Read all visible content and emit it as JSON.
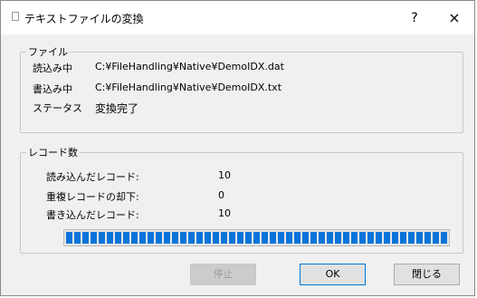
{
  "window": {
    "title": "テキストファイルの変換",
    "help_label": "?",
    "close_label": "×"
  },
  "file_group": {
    "legend": "ファイル",
    "read_label": "読込み中",
    "read_value": "C:¥FileHandling¥Native¥DemoIDX.dat",
    "write_label": "書込み中",
    "write_value": "C:¥FileHandling¥Native¥DemoIDX.txt",
    "status_label": "ステータス",
    "status_value": "変換完了"
  },
  "record_group": {
    "legend": "レコード数",
    "read_label": "読み込んだレコード:",
    "read_value": "10",
    "dup_label": "重複レコードの却下:",
    "dup_value": "0",
    "written_label": "書き込んだレコード:",
    "written_value": "10",
    "progress": 1.0
  },
  "buttons": {
    "stop": "停止",
    "ok": "OK",
    "close": "閉じる"
  }
}
